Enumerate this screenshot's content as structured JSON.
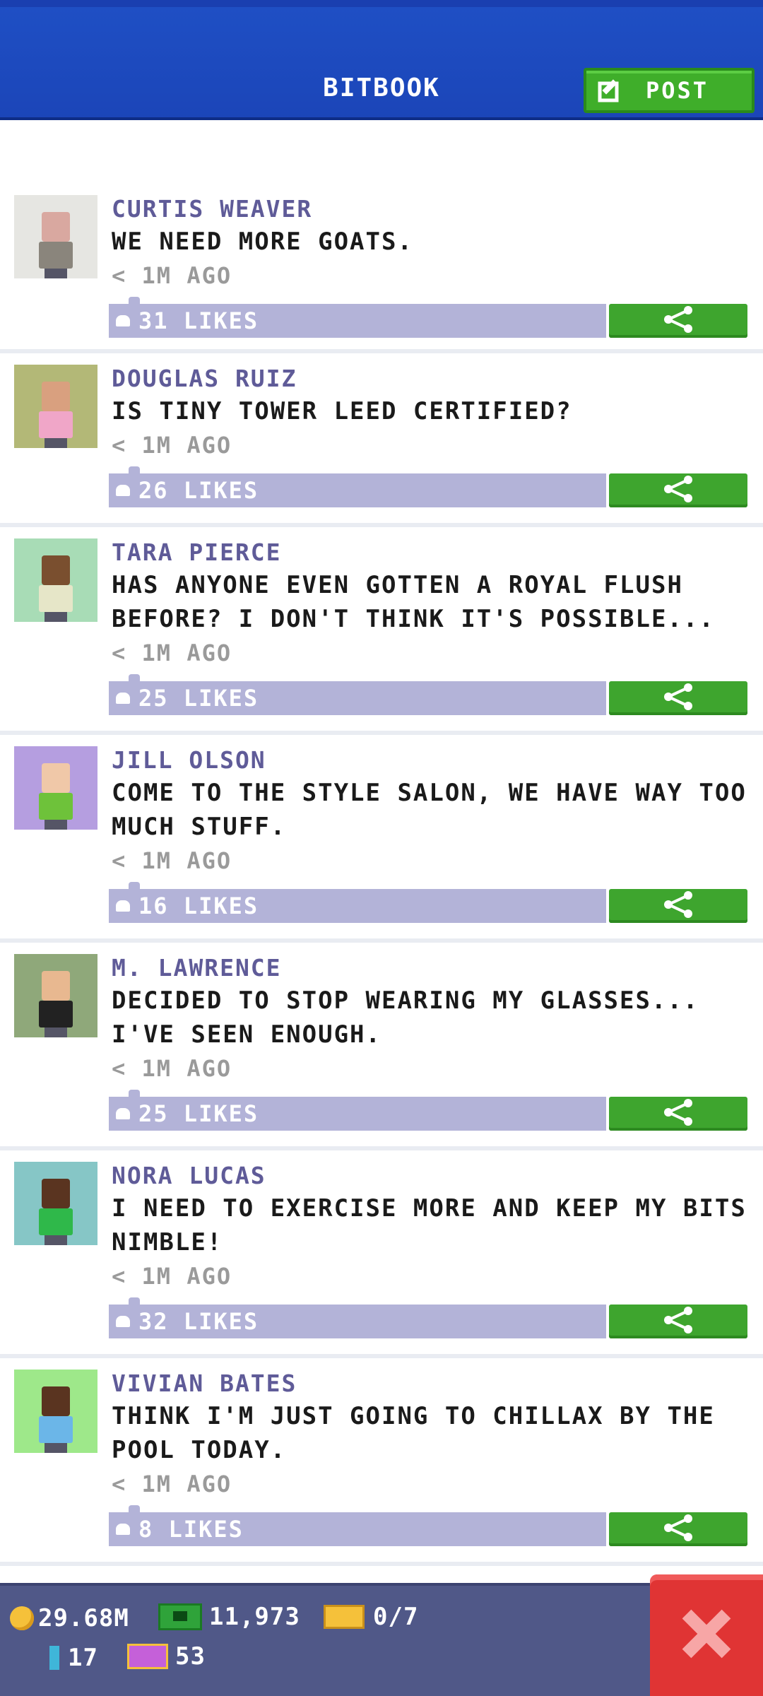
{
  "header": {
    "title": "BITBOOK",
    "post_label": "POST"
  },
  "posts": [
    {
      "author": "CURTIS WEAVER",
      "message": "WE NEED MORE GOATS.",
      "time": "< 1M AGO",
      "likes": "31 LIKES",
      "avatar_bg": "#e6e6e2",
      "head": "#d9a8a0",
      "body": "#8a857c"
    },
    {
      "author": "DOUGLAS RUIZ",
      "message": "IS TINY TOWER LEED CERTIFIED?",
      "time": "< 1M AGO",
      "likes": "26 LIKES",
      "avatar_bg": "#b3b877",
      "head": "#d9a07f",
      "body": "#f0a6c8"
    },
    {
      "author": "TARA PIERCE",
      "message": "HAS ANYONE EVEN GOTTEN A ROYAL FLUSH BEFORE? I DON'T THINK IT'S POSSIBLE...",
      "time": "< 1M AGO",
      "likes": "25 LIKES",
      "avatar_bg": "#a8dcb6",
      "head": "#7a4f2f",
      "body": "#e6e6c8"
    },
    {
      "author": "JILL OLSON",
      "message": "COME TO THE STYLE SALON, WE HAVE WAY TOO MUCH STUFF.",
      "time": "< 1M AGO",
      "likes": "16 LIKES",
      "avatar_bg": "#b59ee0",
      "head": "#f0c8a8",
      "body": "#6ec23a"
    },
    {
      "author": "M. LAWRENCE",
      "message": "DECIDED TO STOP WEARING MY GLASSES... I'VE SEEN ENOUGH.",
      "time": "< 1M AGO",
      "likes": "25 LIKES",
      "avatar_bg": "#8fa87a",
      "head": "#e8b890",
      "body": "#222222"
    },
    {
      "author": "NORA LUCAS",
      "message": "I NEED TO EXERCISE MORE AND KEEP MY BITS NIMBLE!",
      "time": "< 1M AGO",
      "likes": "32 LIKES",
      "avatar_bg": "#86c6c6",
      "head": "#5a3420",
      "body": "#2fb84a"
    },
    {
      "author": "VIVIAN BATES",
      "message": "THINK I'M JUST GOING TO CHILLAX BY THE POOL TODAY.",
      "time": "< 1M AGO",
      "likes": "8 LIKES",
      "avatar_bg": "#9ee88a",
      "head": "#5a3420",
      "body": "#6bb6e8"
    }
  ],
  "footer": {
    "coins": "29.68M",
    "bux": "11,973",
    "tickets": "0/7",
    "level": "17",
    "vip": "53"
  },
  "colors": {
    "header_blue": "#1b45b8",
    "post_green": "#3fae2a",
    "author_purple": "#5f5b98",
    "like_bar": "#b3b3d8",
    "share_green": "#3ea52e",
    "footer_bg": "#505888",
    "close_red": "#e03434"
  }
}
